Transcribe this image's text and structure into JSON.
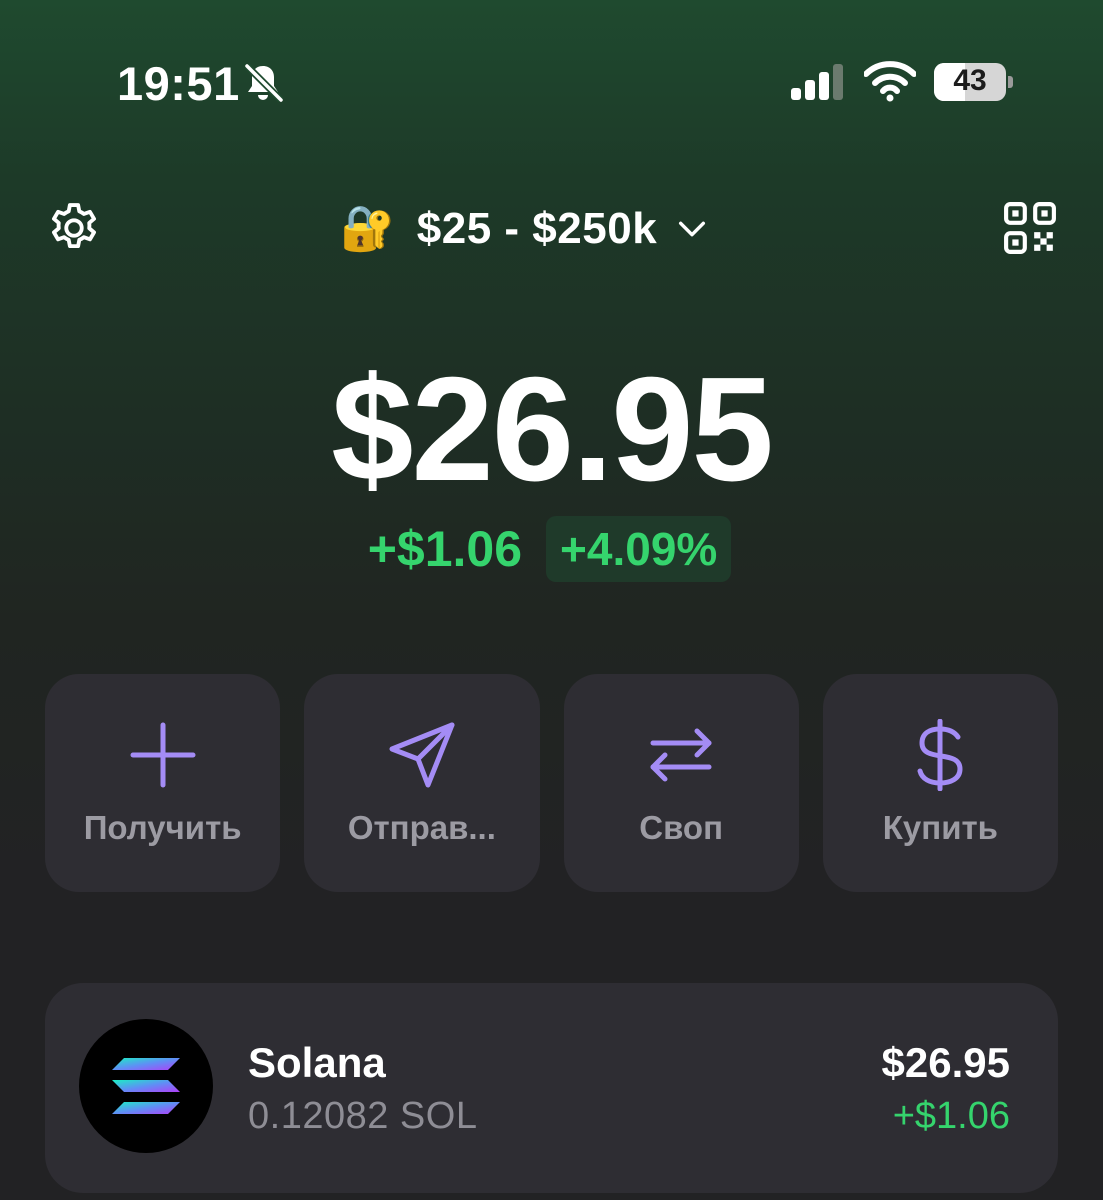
{
  "status_bar": {
    "time": "19:51",
    "battery_level": "43",
    "battery_fraction": 0.43,
    "icons": [
      "bell-slash-icon",
      "cellular-signal-icon",
      "wifi-icon",
      "battery-icon"
    ]
  },
  "header": {
    "settings_icon": "gear-icon",
    "account_emoji": "🔐",
    "account_name": "$25 - $250k",
    "account_chevron": "chevron-down-icon",
    "qr_icon": "qr-code-icon"
  },
  "balance": {
    "total": "$26.95",
    "change_abs": "+$1.06",
    "change_pct": "+4.09%"
  },
  "actions": [
    {
      "label": "Получить",
      "icon": "plus-icon"
    },
    {
      "label": "Отправ...",
      "icon": "send-icon"
    },
    {
      "label": "Своп",
      "icon": "swap-icon"
    },
    {
      "label": "Купить",
      "icon": "dollar-icon"
    }
  ],
  "tokens": [
    {
      "name": "Solana",
      "amount": "0.12082 SOL",
      "value": "$26.95",
      "change": "+$1.06",
      "icon": "solana-logo-icon"
    }
  ],
  "colors": {
    "accent_purple": "#a48cf5",
    "positive_green": "#35d46d",
    "card_bg": "#2e2d33",
    "label_gray": "#9c9ba3"
  }
}
